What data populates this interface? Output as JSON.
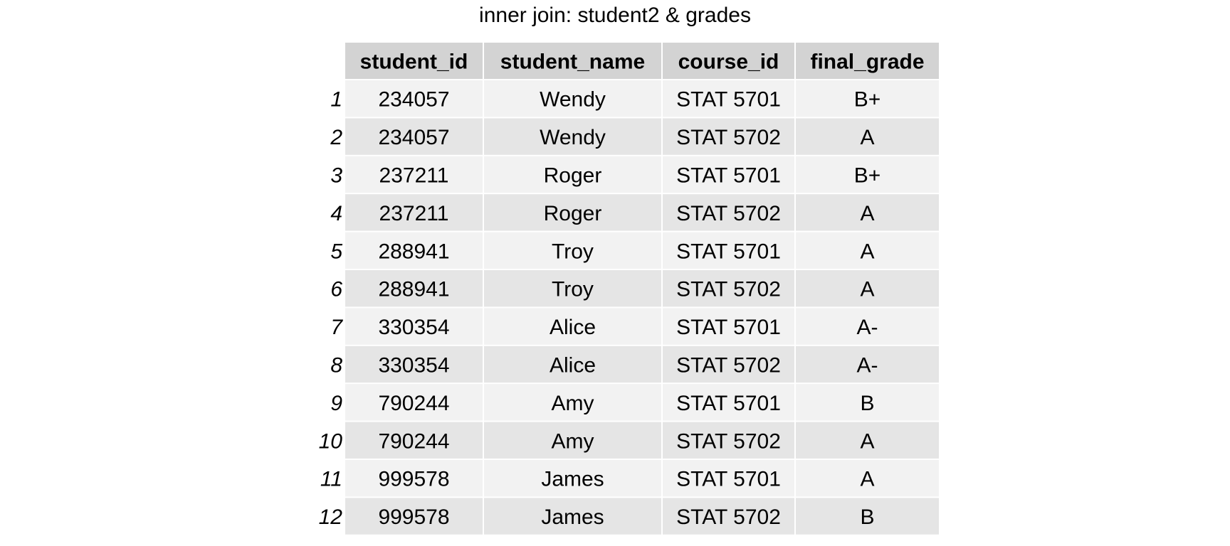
{
  "chart_data": {
    "type": "table",
    "title": "inner join: student2 & grades",
    "columns": [
      "student_id",
      "student_name",
      "course_id",
      "final_grade"
    ],
    "row_labels": [
      "1",
      "2",
      "3",
      "4",
      "5",
      "6",
      "7",
      "8",
      "9",
      "10",
      "11",
      "12"
    ],
    "rows": [
      [
        "234057",
        "Wendy",
        "STAT 5701",
        "B+"
      ],
      [
        "234057",
        "Wendy",
        "STAT 5702",
        "A"
      ],
      [
        "237211",
        "Roger",
        "STAT 5701",
        "B+"
      ],
      [
        "237211",
        "Roger",
        "STAT 5702",
        "A"
      ],
      [
        "288941",
        "Troy",
        "STAT 5701",
        "A"
      ],
      [
        "288941",
        "Troy",
        "STAT 5702",
        "A"
      ],
      [
        "330354",
        "Alice",
        "STAT 5701",
        "A-"
      ],
      [
        "330354",
        "Alice",
        "STAT 5702",
        "A-"
      ],
      [
        "790244",
        "Amy",
        "STAT 5701",
        "B"
      ],
      [
        "790244",
        "Amy",
        "STAT 5702",
        "A"
      ],
      [
        "999578",
        "James",
        "STAT 5701",
        "A"
      ],
      [
        "999578",
        "James",
        "STAT 5702",
        "B"
      ]
    ]
  },
  "colors": {
    "header_fill": "#d3d3d3",
    "row_fill_odd": "#f2f2f2",
    "row_fill_even": "#e5e5e5",
    "grid_line": "#ffffff",
    "text": "#000000"
  }
}
